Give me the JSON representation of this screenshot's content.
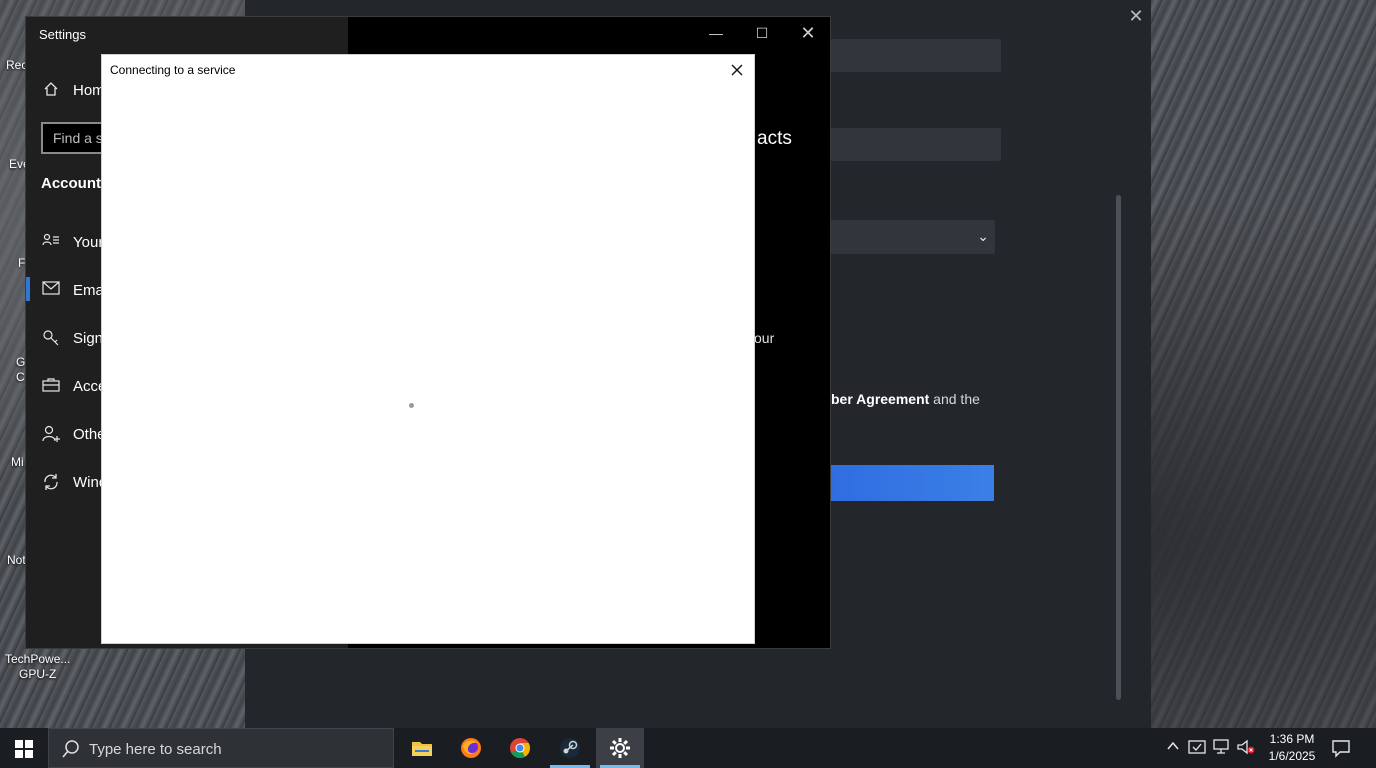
{
  "background_window": {
    "heading_fragment": "acts",
    "text_fragment_1": "our",
    "agreement_text_bold": "ber Agreement",
    "agreement_text_rest": " and the",
    "accent_button_color": "#2f6de1"
  },
  "desktop_icons": [
    {
      "label": "Rec",
      "icon": "recycle-bin-icon"
    },
    {
      "label": "Eve",
      "icon": "app-shortcut-icon"
    },
    {
      "label": "F",
      "icon": "firefox-shortcut-icon"
    },
    {
      "label": "G",
      "icon": "chrome-shortcut-icon"
    },
    {
      "label": "C",
      "icon": "chrome-shortcut-icon"
    },
    {
      "label": "Mi",
      "icon": "edge-shortcut-icon"
    },
    {
      "label": "Not",
      "icon": "notepad-shortcut-icon"
    },
    {
      "label": "TechPowe...",
      "icon": "gpuz-shortcut-icon"
    },
    {
      "label": "GPU-Z",
      "icon": "gpuz-shortcut-icon"
    }
  ],
  "settings": {
    "title": "Settings",
    "home_label": "Hom",
    "search_placeholder": "Find a s",
    "section_title": "Accounts",
    "nav": [
      {
        "label": "Your",
        "icon": "person-card-icon"
      },
      {
        "label": "Ema",
        "icon": "mail-icon"
      },
      {
        "label": "Sign",
        "icon": "key-icon"
      },
      {
        "label": "Acce",
        "icon": "briefcase-icon"
      },
      {
        "label": "Othe",
        "icon": "add-person-icon"
      },
      {
        "label": "Wind",
        "icon": "sync-icon"
      }
    ],
    "window_controls": {
      "minimize": "—",
      "maximize": "☐",
      "close": "✕"
    }
  },
  "dialog": {
    "title": "Connecting to a service",
    "close_glyph": "✕",
    "loading": true
  },
  "taskbar": {
    "search_placeholder": "Type here to search",
    "pinned": [
      {
        "name": "File Explorer",
        "icon": "folder-icon"
      },
      {
        "name": "Firefox",
        "icon": "firefox-icon"
      },
      {
        "name": "Chrome",
        "icon": "chrome-icon"
      },
      {
        "name": "Steam",
        "icon": "steam-icon"
      },
      {
        "name": "Settings",
        "icon": "gear-icon"
      }
    ],
    "tray": [
      "chevron-up-icon",
      "security-icon",
      "network-icon",
      "volume-muted-icon"
    ],
    "time": "1:36 PM",
    "date": "1/6/2025"
  }
}
